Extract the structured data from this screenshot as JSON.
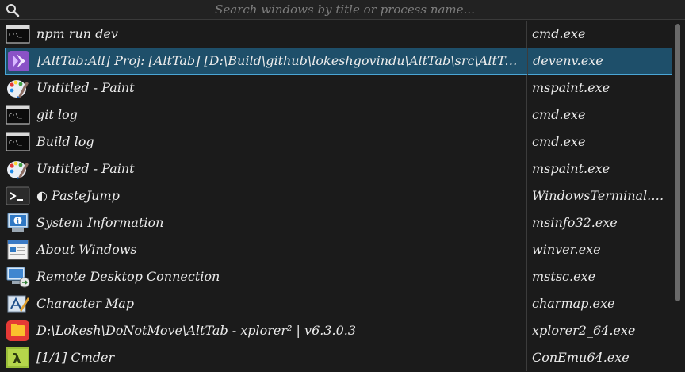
{
  "search": {
    "placeholder": "Search windows by title or process name...",
    "value": ""
  },
  "windows": [
    {
      "title": "npm run dev",
      "process": "cmd.exe",
      "icon": "cmd-icon",
      "selected": false
    },
    {
      "title": "[AltTab:All]  Proj:  [AltTab]   [D:\\Build\\github\\lokeshgovindu\\AltTab\\src\\AltTab.sln]",
      "process": "devenv.exe",
      "icon": "visual-studio-icon",
      "selected": true
    },
    {
      "title": "Untitled - Paint",
      "process": "mspaint.exe",
      "icon": "paint-icon",
      "selected": false
    },
    {
      "title": "git log",
      "process": "cmd.exe",
      "icon": "cmd-icon",
      "selected": false
    },
    {
      "title": "Build log",
      "process": "cmd.exe",
      "icon": "cmd-icon",
      "selected": false
    },
    {
      "title": "Untitled - Paint",
      "process": "mspaint.exe",
      "icon": "paint-icon",
      "selected": false
    },
    {
      "title": "◐ PasteJump",
      "process": "WindowsTerminal.exe",
      "icon": "terminal-icon",
      "selected": false
    },
    {
      "title": "System Information",
      "process": "msinfo32.exe",
      "icon": "system-info-icon",
      "selected": false
    },
    {
      "title": "About Windows",
      "process": "winver.exe",
      "icon": "about-windows-icon",
      "selected": false
    },
    {
      "title": "Remote Desktop Connection",
      "process": "mstsc.exe",
      "icon": "remote-desktop-icon",
      "selected": false
    },
    {
      "title": "Character Map",
      "process": "charmap.exe",
      "icon": "character-map-icon",
      "selected": false
    },
    {
      "title": "D:\\Lokesh\\DoNotMove\\AltTab - xplorer² | v6.3.0.3",
      "process": "xplorer2_64.exe",
      "icon": "xplorer-icon",
      "selected": false
    },
    {
      "title": "[1/1] Cmder",
      "process": "ConEmu64.exe",
      "icon": "cmder-icon",
      "selected": false
    }
  ],
  "colors": {
    "background": "#1b1b1b",
    "selection": "#1e4f6a",
    "selection_border": "#4aa6d6",
    "text": "#ececec"
  }
}
